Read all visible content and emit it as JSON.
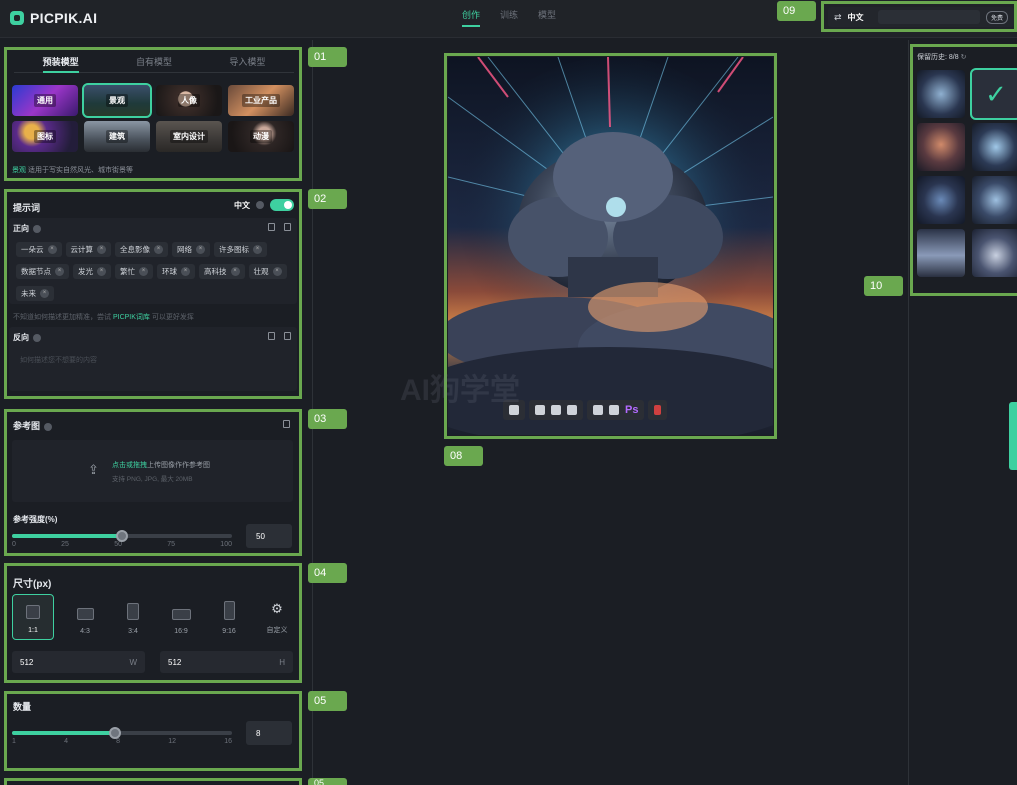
{
  "app": {
    "title": "PICPIK.AI"
  },
  "nav": {
    "tabs": [
      {
        "label": "创作",
        "active": true
      },
      {
        "label": "训练",
        "active": false
      },
      {
        "label": "模型",
        "active": false
      }
    ]
  },
  "annotations": [
    "01",
    "02",
    "03",
    "04",
    "05",
    "08",
    "09",
    "10",
    "05"
  ],
  "models": {
    "tabs": [
      {
        "label": "预装模型",
        "active": true
      },
      {
        "label": "自有模型",
        "active": false
      },
      {
        "label": "导入模型",
        "active": false
      }
    ],
    "items": [
      {
        "label": "通用",
        "selected": false
      },
      {
        "label": "景观",
        "selected": true
      },
      {
        "label": "人像",
        "selected": false
      },
      {
        "label": "工业产品",
        "selected": false
      },
      {
        "label": "图标",
        "selected": false
      },
      {
        "label": "建筑",
        "selected": false
      },
      {
        "label": "室内设计",
        "selected": false
      },
      {
        "label": "动漫",
        "selected": false
      }
    ],
    "hint_name": "景观",
    "hint_text": "适用于写实自然风光、城市街景等"
  },
  "prompt": {
    "title": "提示词",
    "lang_label": "中文",
    "positive_label": "正向",
    "tags": [
      "一朵云",
      "云计算",
      "全息影像",
      "网络",
      "许多图标",
      "数据节点",
      "发光",
      "繁忙",
      "环球",
      "高科技",
      "壮观",
      "未来"
    ],
    "tip_before": "不知道如何描述更加精准，尝试",
    "tip_link": "PICPIK词库",
    "tip_after": "可以更好发挥",
    "negative_label": "反向",
    "negative_placeholder": "如何描述您不想要的内容"
  },
  "reference": {
    "title": "参考图",
    "upload_link": "点击或拖拽",
    "upload_text": "上传图像作作参考图",
    "upload_sub": "支持 PNG, JPG, 最大 20MB",
    "strength_label": "参考强度(%)",
    "strength_value": "50",
    "strength_fraction": 0.5,
    "ticks": [
      "0",
      "25",
      "50",
      "75",
      "100"
    ]
  },
  "size": {
    "title": "尺寸(px)",
    "options": [
      {
        "label": "1:1",
        "selected": true
      },
      {
        "label": "4:3",
        "selected": false
      },
      {
        "label": "3:4",
        "selected": false
      },
      {
        "label": "16:9",
        "selected": false
      },
      {
        "label": "9:16",
        "selected": false
      },
      {
        "label": "自定义",
        "selected": false
      }
    ],
    "width": "512",
    "width_unit": "W",
    "height": "512",
    "height_unit": "H"
  },
  "quantity": {
    "title": "数量",
    "value": "8",
    "fraction": 0.47,
    "ticks": [
      "1",
      "4",
      "8",
      "12",
      "16"
    ]
  },
  "topright": {
    "lang": "中文",
    "button": "免费"
  },
  "history": {
    "label": "保留历史: 8/8"
  },
  "toolbar": {
    "ps_label": "Ps"
  },
  "watermark": "AI狗学堂",
  "colors": {
    "accent": "#3ed0a0",
    "annotation": "#6aa84f",
    "bg": "#1b1e24"
  }
}
